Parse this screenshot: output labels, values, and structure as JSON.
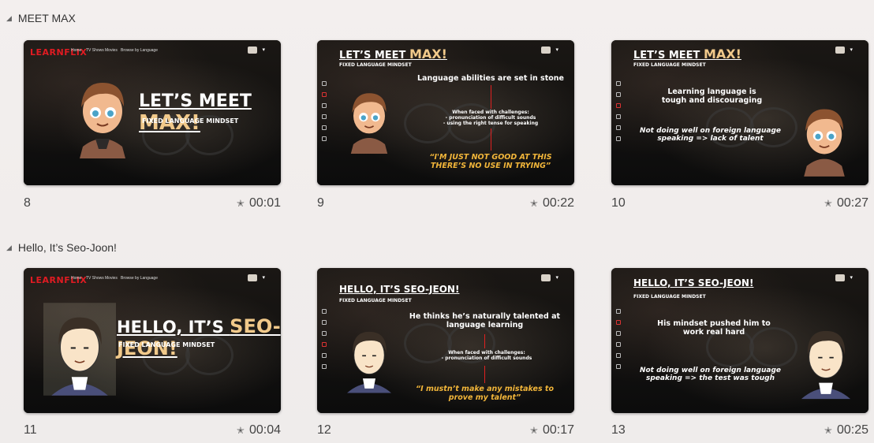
{
  "sections": [
    {
      "title": "MEET MAX"
    },
    {
      "title": "Hello, It’s Seo-Joon!"
    }
  ],
  "slides": {
    "s8": {
      "num": "8",
      "time": "00:01",
      "logo": "LEARNFLIX",
      "nav": [
        "Home",
        "TV Shows",
        "Movies",
        "Browse by Language"
      ],
      "title_a": "LET’S MEET ",
      "title_b": "MAX!",
      "subtitle": "FIXED LANGUAGE MINDSET"
    },
    "s9": {
      "num": "9",
      "time": "00:22",
      "title_a": "LET’S MEET ",
      "title_b": "MAX!",
      "subtitle": "FIXED LANGUAGE MINDSET",
      "heading": "Language abilities are set in stone",
      "challenge": "When faced with challenges:\n- pronunciation of difficult sounds\n- using the right tense for speaking",
      "quote": "“I'M JUST NOT GOOD AT THIS\nTHERE’S NO USE IN TRYING”"
    },
    "s10": {
      "num": "10",
      "time": "00:27",
      "title_a": "LET’S MEET ",
      "title_b": "MAX!",
      "subtitle": "FIXED LANGUAGE MINDSET",
      "line1": "Learning language is\ntough and discouraging",
      "line2": "Not doing well on foreign language\nspeaking => lack of talent"
    },
    "s11": {
      "num": "11",
      "time": "00:04",
      "logo": "LEARNFLIX",
      "nav": [
        "Home",
        "TV Shows",
        "Movies",
        "Browse by Language"
      ],
      "title_a": "HELLO, IT’S ",
      "title_b": "SEO-JEON!",
      "subtitle": "FIXED LANGUAGE MINDSET"
    },
    "s12": {
      "num": "12",
      "time": "00:17",
      "title_a": "HELLO, IT’S SEO-JEON!",
      "subtitle": "FIXED LANGUAGE MINDSET",
      "heading": "He thinks he’s naturally talented at\nlanguage learning",
      "challenge": "When faced with challenges:\n- pronunciation of difficult sounds",
      "quote": "“I mustn’t make any mistakes to\nprove my talent”"
    },
    "s13": {
      "num": "13",
      "time": "00:25",
      "title_a": "HELLO, IT’S SEO-JEON!",
      "subtitle": "FIXED LANGUAGE MINDSET",
      "line1": "His mindset pushed him to\nwork real hard",
      "line2": "Not doing well on foreign language\nspeaking => the test was tough"
    }
  },
  "icons": {
    "star": "star-icon",
    "caret": "caret-down-icon"
  }
}
